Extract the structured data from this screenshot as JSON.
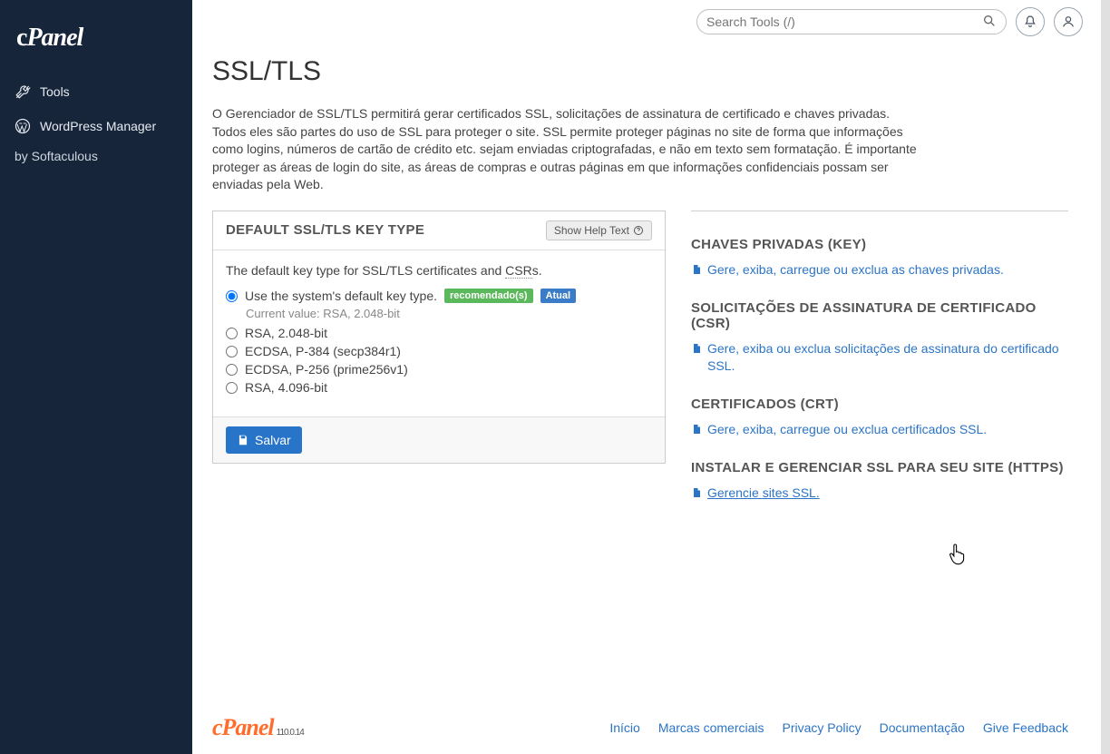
{
  "sidebar": {
    "logo": "cPanel",
    "items": [
      {
        "label": "Tools"
      },
      {
        "label": "WordPress Manager"
      }
    ],
    "subline": "by Softaculous"
  },
  "topbar": {
    "search_placeholder": "Search Tools (/)"
  },
  "page": {
    "title": "SSL/TLS",
    "intro": "O Gerenciador de SSL/TLS permitirá gerar certificados SSL, solicitações de assinatura de certificado e chaves privadas. Todos eles são partes do uso de SSL para proteger o site. SSL permite proteger páginas no site de forma que informações como logins, números de cartão de crédito etc. sejam enviadas criptografadas, e não em texto sem formatação. É importante proteger as áreas de login do site, as áreas de compras e outras páginas em que informações confidenciais possam ser enviadas pela Web."
  },
  "panel": {
    "title": "DEFAULT SSL/TLS KEY TYPE",
    "help_label": "Show Help Text",
    "desc_prefix": "The default key type for SSL/TLS certificates and ",
    "desc_abbrev": "CSR",
    "desc_suffix": "s.",
    "options": [
      {
        "label": "Use the system's default key type.",
        "checked": true
      },
      {
        "label": "RSA, 2.048-bit",
        "checked": false
      },
      {
        "label": "ECDSA, P-384 (secp384r1)",
        "checked": false
      },
      {
        "label": "ECDSA, P-256 (prime256v1)",
        "checked": false
      },
      {
        "label": "RSA, 4.096-bit",
        "checked": false
      }
    ],
    "badge_recommended": "recomendado(s)",
    "badge_current": "Atual",
    "current_value": "Current value: RSA, 2.048-bit",
    "save_label": "Salvar"
  },
  "right": [
    {
      "title": "CHAVES PRIVADAS (KEY)",
      "link": "Gere, exiba, carregue ou exclua as chaves privadas.",
      "active": false
    },
    {
      "title": "SOLICITAÇÕES DE ASSINATURA DE CERTIFICADO (CSR)",
      "link": "Gere, exiba ou exclua solicitações de assinatura do certificado SSL.",
      "active": false
    },
    {
      "title": "CERTIFICADOS (CRT)",
      "link": "Gere, exiba, carregue ou exclua certificados SSL.",
      "active": false
    },
    {
      "title": "INSTALAR E GERENCIAR SSL PARA SEU SITE (HTTPS)",
      "link": "Gerencie sites SSL.",
      "active": true
    }
  ],
  "footer": {
    "logo": "cPanel",
    "version": "110.0.14",
    "links": [
      "Início",
      "Marcas comerciais",
      "Privacy Policy",
      "Documentação",
      "Give Feedback"
    ]
  }
}
